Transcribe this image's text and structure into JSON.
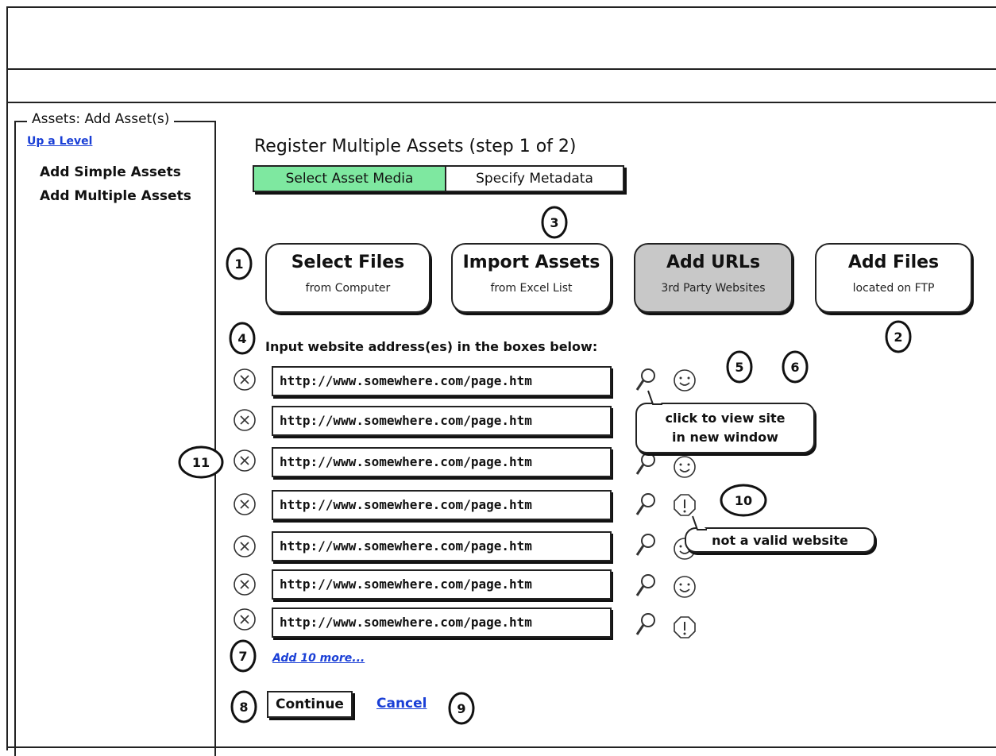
{
  "panel": {
    "title": "Assets: Add Asset(s)",
    "up_link": "Up a Level"
  },
  "sidebar": {
    "items": [
      {
        "label": "Add Simple Assets"
      },
      {
        "label": "Add Multiple Assets"
      }
    ]
  },
  "main": {
    "heading": "Register Multiple Assets (step 1 of 2)",
    "tabs": [
      {
        "label": "Select Asset Media",
        "active": true
      },
      {
        "label": "Specify Metadata",
        "active": false
      }
    ],
    "options": [
      {
        "title": "Select Files",
        "subtitle": "from Computer",
        "selected": false
      },
      {
        "title": "Import Assets",
        "subtitle": "from Excel List",
        "selected": false
      },
      {
        "title": "Add URLs",
        "subtitle": "3rd Party Websites",
        "selected": true
      },
      {
        "title": "Add Files",
        "subtitle": "located on FTP",
        "selected": false
      }
    ],
    "instruction": "Input website address(es) in the boxes below:",
    "url_rows": [
      {
        "value": "http://www.somewhere.com/page.htm",
        "status_icon": "smiley-icon"
      },
      {
        "value": "http://www.somewhere.com/page.htm",
        "status_icon": "smiley-icon"
      },
      {
        "value": "http://www.somewhere.com/page.htm",
        "status_icon": "smiley-icon"
      },
      {
        "value": "http://www.somewhere.com/page.htm",
        "status_icon": "warning-octagon-icon"
      },
      {
        "value": "http://www.somewhere.com/page.htm",
        "status_icon": "smiley-icon"
      },
      {
        "value": "http://www.somewhere.com/page.htm",
        "status_icon": "smiley-icon"
      },
      {
        "value": "http://www.somewhere.com/page.htm",
        "status_icon": "warning-octagon-icon"
      }
    ],
    "add_more": "Add 10 more...",
    "continue_label": "Continue",
    "cancel_label": "Cancel"
  },
  "callouts": {
    "view_site": [
      "click to view site",
      "in new window"
    ],
    "invalid": "not a valid website",
    "numbers": [
      "1",
      "2",
      "3",
      "4",
      "5",
      "6",
      "7",
      "8",
      "9",
      "10",
      "11"
    ]
  },
  "colors": {
    "active_tab": "#7ee8a0",
    "selected_option": "#c8c8c8",
    "link": "#1a3fd6"
  }
}
